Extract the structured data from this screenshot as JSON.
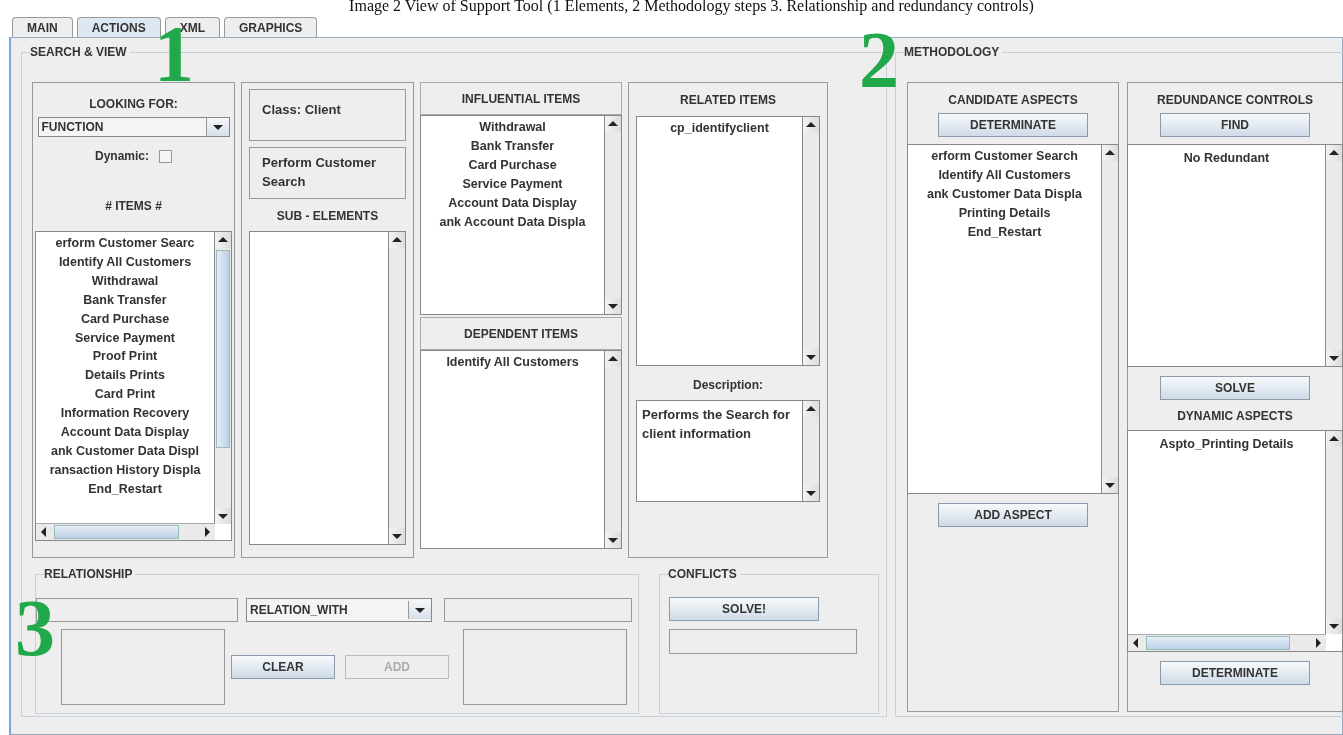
{
  "caption": "Image 2 View of Support Tool (1 Elements, 2 Methodology steps 3. Relationship and redundancy controls)",
  "tabs": [
    {
      "label": "MAIN",
      "selected": false
    },
    {
      "label": "ACTIONS",
      "selected": true
    },
    {
      "label": "XML",
      "selected": false
    },
    {
      "label": "GRAPHICS",
      "selected": false
    }
  ],
  "search_view": {
    "title": "SEARCH & VIEW",
    "looking_for": {
      "label": "LOOKING FOR:",
      "value": "FUNCTION",
      "dynamic": {
        "label": "Dynamic:",
        "checked": false
      }
    },
    "items_label": "# ITEMS #",
    "items": [
      "erform Customer Searc",
      "Identify All Customers",
      "Withdrawal",
      "Bank Transfer",
      "Card Purchase",
      "Service Payment",
      "Proof Print",
      "Details Prints",
      "Card Print",
      "Information Recovery",
      "Account Data Display",
      "ank Customer Data Displ",
      "ransaction History Displa",
      "End_Restart"
    ],
    "class_label": "Class: Client",
    "element_name": "Perform Customer Search",
    "sub_elements_label": "SUB - ELEMENTS",
    "influential": {
      "title": "INFLUENTIAL ITEMS",
      "items": [
        "Withdrawal",
        "Bank Transfer",
        "Card Purchase",
        "Service Payment",
        "Account Data Display",
        "ank Account Data Displa"
      ]
    },
    "dependent": {
      "title": "DEPENDENT ITEMS",
      "items": [
        "Identify All Customers"
      ]
    },
    "related": {
      "title": "RELATED ITEMS",
      "items": [
        "cp_identifyclient"
      ]
    },
    "description": {
      "label": "Description:",
      "text": "Performs the Search for client information"
    }
  },
  "relationship": {
    "title": "RELATIONSHIP",
    "dropdown": "RELATION_WITH",
    "buttons": [
      {
        "label": "CLEAR",
        "disabled": false
      },
      {
        "label": "ADD",
        "disabled": true
      }
    ]
  },
  "conflicts": {
    "title": "CONFLICTS",
    "button": "SOLVE!"
  },
  "methodology": {
    "title": "METHODOLOGY",
    "candidate": {
      "title": "CANDIDATE ASPECTS",
      "button": "DETERMINATE",
      "items": [
        "erform Customer Search",
        "Identify All Customers",
        "ank Customer Data Displa",
        "Printing Details",
        "End_Restart"
      ],
      "add_button": "ADD ASPECT"
    },
    "redundance": {
      "title": "REDUNDANCE CONTROLS",
      "button": "FIND",
      "items": [
        "No Redundant"
      ],
      "solve_button": "SOLVE",
      "dynamic_title": "DYNAMIC ASPECTS",
      "dynamic_items": [
        "Aspto_Printing Details"
      ],
      "determinate_button": "DETERMINATE"
    }
  },
  "annotations": [
    "1",
    "2",
    "3"
  ]
}
